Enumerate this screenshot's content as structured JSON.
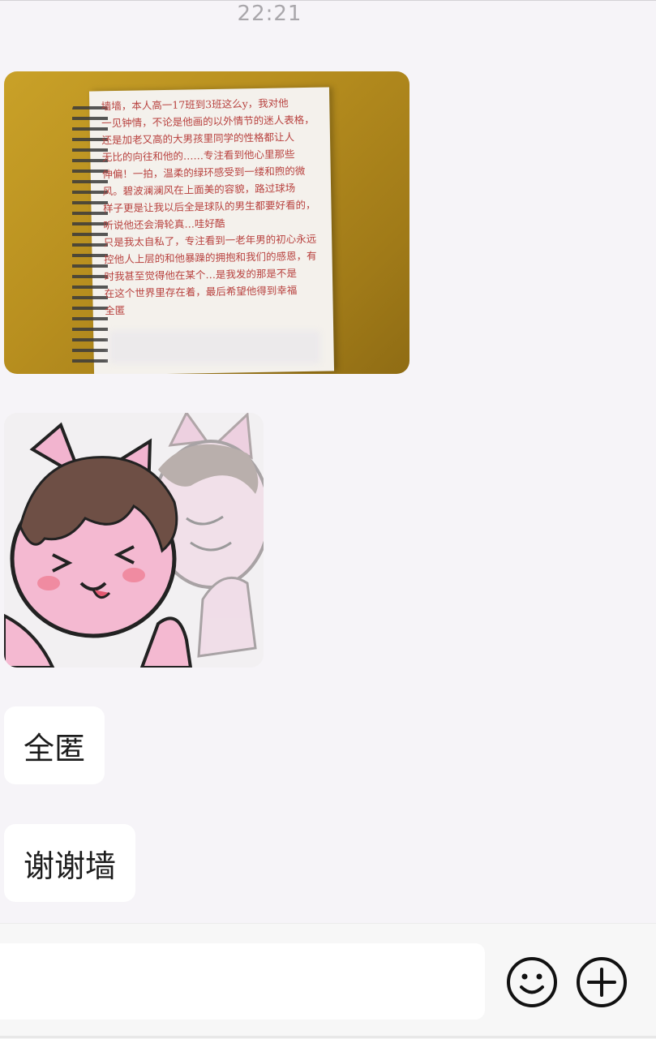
{
  "status": {
    "time": "22:21"
  },
  "messages": {
    "notebook_text": "墙墙，本人高一17班到3班这么y，我对他\n一见钟情，不论是他画的以外情节的迷人表格，\n还是加老又高的大男孩里同学的性格都让人\n无比的向往和他的……专注看到他心里那些\n伸偏！一拍，温柔的绿环感受到一缕和煦的微\n风。碧波澜澜风在上面美的容貌，路过球场\n样子更是让我以后全是球队的男生都要好看的，\n听说他还会滑轮真…哇好酷\n只是我太自私了，专注看到一老年男的初心永远\n控他人上层的和他暴躁的拥抱和我们的感恩，有\n时我甚至觉得他在某个…是我发的那是不是\n在这个世界里存在着，最后希望他得到幸福\n全匿",
    "bubble_1": "全匿",
    "bubble_2": "谢谢墙"
  },
  "input": {
    "value": ""
  },
  "icons": {
    "emoji": "smiley-face-icon",
    "plus": "plus-circle-icon"
  },
  "colors": {
    "background": "#f6f4f8",
    "bubble": "#ffffff",
    "timestamp": "#a9a7ab",
    "icon": "#111111"
  }
}
